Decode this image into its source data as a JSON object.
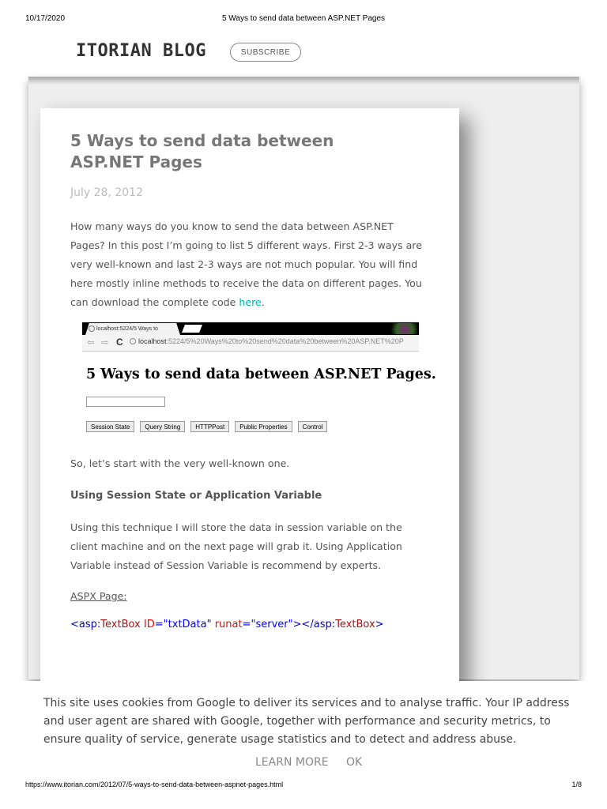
{
  "print_header": {
    "date": "10/17/2020",
    "title": "5 Ways to send data between ASP.NET Pages"
  },
  "blog": {
    "brand": "ITORIAN BLOG",
    "subscribe_label": "SUBSCRIBE"
  },
  "post": {
    "title": "5 Ways to send data between ASP.NET Pages",
    "date": "July 28, 2012",
    "intro": "How many ways do you know to send the data between ASP.NET Pages? In this post I’m going to list 5 different ways. First 2-3 ways are very well-known and last 2-3 ways are not much popular. You will find here mostly inline methods to receive the data on different pages. You can download the complete code ",
    "intro_link": "here",
    "intro_end": ".",
    "screenshot": {
      "tab_title": "localhost:5224/5 Ways to",
      "url_host": "localhost",
      "url_path": ":5224/5%20Ways%20to%20send%20data%20between%20ASP.NET%20P",
      "heading": "5 Ways to send data between ASP.NET Pages.",
      "buttons": [
        "Session State",
        "Query String",
        "HTTPPost",
        "Public Properties",
        "Control"
      ]
    },
    "lead2": "So, let’s start with the very well-known one.",
    "subhead": "Using Session State or Application Variable",
    "paragraph3": "Using this technique I will store the data in session variable on the client machine and on the next page will grab it. Using Application Variable instead of Session Variable is recommend by experts.",
    "aspx_label": "ASPX Page:",
    "code": {
      "open_lt": "<",
      "tag_prefix": "asp",
      "colon": ":",
      "element": "TextBox",
      "attr1": "ID",
      "eq1": "=",
      "val1": "\"txtData\"",
      "attr2": "runat",
      "eq2": "=",
      "val2": "\"server\"",
      "gt_close": "></",
      "close_prefix": "asp",
      "close_colon": ":",
      "close_element": "TextBox",
      "final_gt": ">"
    }
  },
  "cookie_banner": {
    "text": "This site uses cookies from Google to deliver its services and to analyse traffic. Your IP address and user agent are shared with Google, together with performance and security metrics, to ensure quality of service, generate usage statistics and to detect and address abuse.",
    "learn_more": "LEARN MORE",
    "ok": "OK"
  },
  "print_footer": {
    "url": "https://www.itorian.com/2012/07/5-ways-to-send-data-between-aspnet-pages.html",
    "page": "1/8"
  },
  "colors": {
    "link": "#00b3b3",
    "title": "#777777",
    "body_text": "#555555",
    "code_tag": "#0000cc",
    "code_element": "#a31515",
    "code_attr": "#ff0000",
    "code_value": "#0000ff"
  }
}
